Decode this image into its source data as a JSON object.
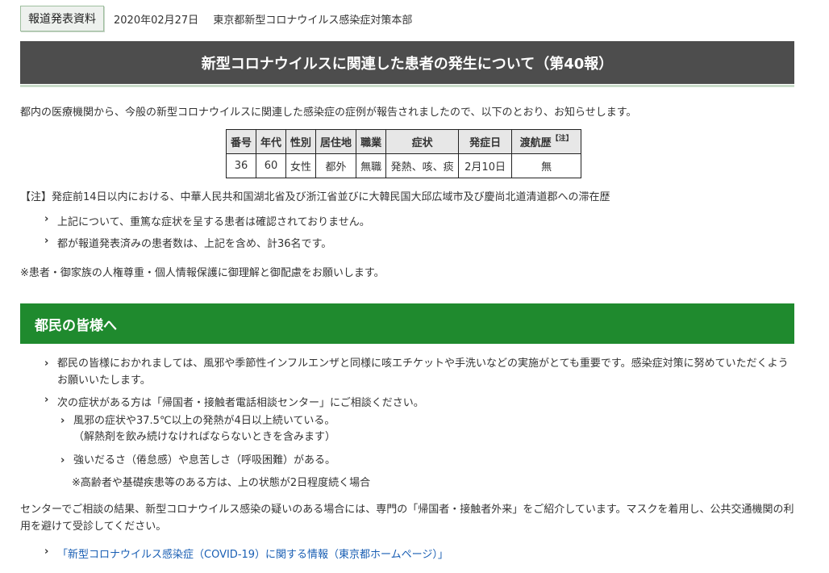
{
  "header": {
    "badge": "報道発表資料",
    "date": "2020年02月27日",
    "department": "東京都新型コロナウイルス感染症対策本部"
  },
  "title": "新型コロナウイルスに関連した患者の発生について（第40報）",
  "intro": "都内の医療機関から、今般の新型コロナウイルスに関連した感染症の症例が報告されましたので、以下のとおり、お知らせします。",
  "table": {
    "headers": [
      "番号",
      "年代",
      "性別",
      "居住地",
      "職業",
      "症状",
      "発症日",
      "渡航歴"
    ],
    "header_note": "【注】",
    "row": [
      "36",
      "60",
      "女性",
      "都外",
      "無職",
      "発熱、咳、痰",
      "2月10日",
      "無"
    ]
  },
  "note": "【注】発症前14日以内における、中華人民共和国湖北省及び浙江省並びに大韓民国大邱広域市及び慶尚北道清道郡への滞在歴",
  "bullets": [
    "上記について、重篤な症状を呈する患者は確認されておりません。",
    "都が報道発表済みの患者数は、上記を含め、計36名です。"
  ],
  "privacy": "※患者・御家族の人権尊重・個人情報保護に御理解と御配慮をお願いします。",
  "section": {
    "title": "都民の皆様へ",
    "p1": "都民の皆様におかれましては、風邪や季節性インフルエンザと同様に咳エチケットや手洗いなどの実施がとても重要です。感染症対策に努めていただくようお願いいたします。",
    "p2": "次の症状がある方は「帰国者・接触者電話相談センター」にご相談ください。",
    "sub1_line1": "風邪の症状や37.5℃以上の発熱が4日以上続いている。",
    "sub1_line2": "（解熱剤を飲み続けなければならないときを含みます）",
    "sub2": "強いだるさ（倦怠感）や息苦しさ（呼吸困難）がある。",
    "elderly": "※高齢者や基礎疾患等のある方は、上の状態が2日程度続く場合",
    "p3": "センターでご相談の結果、新型コロナウイルス感染の疑いのある場合には、専門の「帰国者・接触者外来」をご紹介しています。マスクを着用し、公共交通機関の利用を避けて受診してください。",
    "link": "「新型コロナウイルス感染症（COVID-19）に関する情報（東京都ホームページ）」"
  },
  "icons": {
    "bullet": "chevron-right-icon"
  },
  "colors": {
    "title_bar": "#4d4d4d",
    "section_bar": "#1f8a2e",
    "link": "#1a5fb4"
  }
}
